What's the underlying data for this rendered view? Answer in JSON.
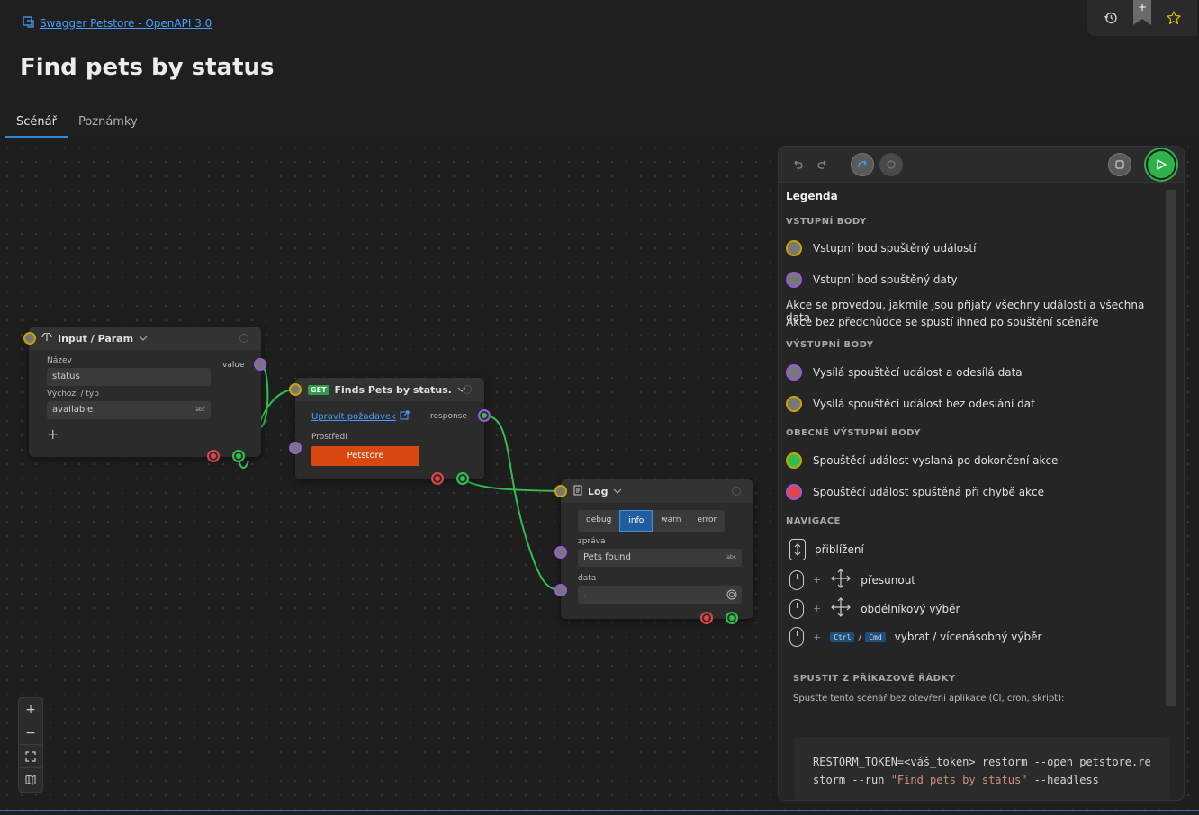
{
  "breadcrumb": {
    "link": "Swagger Petstore - OpenAPI 3.0"
  },
  "page": {
    "title": "Find pets by status"
  },
  "tabs": [
    {
      "label": "Scénář",
      "active": true
    },
    {
      "label": "Poznámky",
      "active": false
    }
  ],
  "top_actions": {
    "bookmark_plus": "+"
  },
  "nodes": {
    "input": {
      "title": "Input / Param",
      "name_label": "Název",
      "name_value": "status",
      "default_label": "Výchozí / typ",
      "default_value": "available",
      "type_hint": "abc",
      "output_label": "value",
      "add": "+"
    },
    "get": {
      "method": "GET",
      "title": "Finds Pets by status.",
      "edit_link": "Upravit požadavek",
      "output_label": "response",
      "env_label": "Prostředí",
      "env_value": "Petstore"
    },
    "log": {
      "title": "Log",
      "levels": [
        "debug",
        "info",
        "warn",
        "error"
      ],
      "active_level": "info",
      "message_label": "zpráva",
      "message_value": "Pets found",
      "type_hint": "abc",
      "data_label": "data",
      "data_value": "."
    }
  },
  "zoom_controls": {
    "in": "+",
    "out": "−"
  },
  "legend": {
    "title": "Legenda",
    "inputs_heading": "VSTUPNÍ BODY",
    "input_event": "Vstupní bod spuštěný událostí",
    "input_data": "Vstupní bod spuštěný daty",
    "note1": "Akce se provedou, jakmile jsou přijaty všechny události a všechna data",
    "note2": "Akce bez předchůdce se spustí ihned po spuštění scénáře",
    "outputs_heading": "VÝSTUPNÍ BODY",
    "output_data": "Vysílá spouštěcí událost a odesílá data",
    "output_event": "Vysílá spouštěcí událost bez odeslání dat",
    "general_heading": "OBECNÉ VÝSTUPNÍ BODY",
    "general_done": "Spouštěcí událost vyslaná po dokončení akce",
    "general_error": "Spouštěcí událost spuštěná při chybě akce",
    "nav_heading": "NAVIGACE",
    "nav_zoom": "přiblížení",
    "nav_pan": "přesunout",
    "nav_rect": "obdélníkový výběr",
    "nav_multi": "vybrat / vícenásobný výběr",
    "key_ctrl": "Ctrl",
    "key_cmd": "Cmd",
    "plus": "+",
    "slash": "/"
  },
  "cli": {
    "title": "SPUSTIT Z PŘÍKAZOVÉ ŘÁDKY",
    "desc": "Spusťte tento scénář bez otevření aplikace (CI, cron, skript):",
    "cmd_prefix": "RESTORM_TOKEN=<váš_token> restorm --open petstore.restorm --run ",
    "cmd_string": "\"Find pets by status\"",
    "cmd_suffix": " --headless"
  },
  "colors": {
    "accent": "#3a86d6",
    "run": "#2db34a",
    "event_port": "#c9a400",
    "data_port": "#9a59d8",
    "success": "#2fbf4f",
    "error": "#e04444",
    "env_button": "#d9480f"
  },
  "icons": {
    "breadcrumb": "api-icon",
    "history": "history-icon",
    "bookmark": "bookmark-icon",
    "star": "star-icon",
    "undo": "undo-icon",
    "redo": "redo-icon",
    "stop": "stop-icon",
    "run": "play-icon"
  }
}
